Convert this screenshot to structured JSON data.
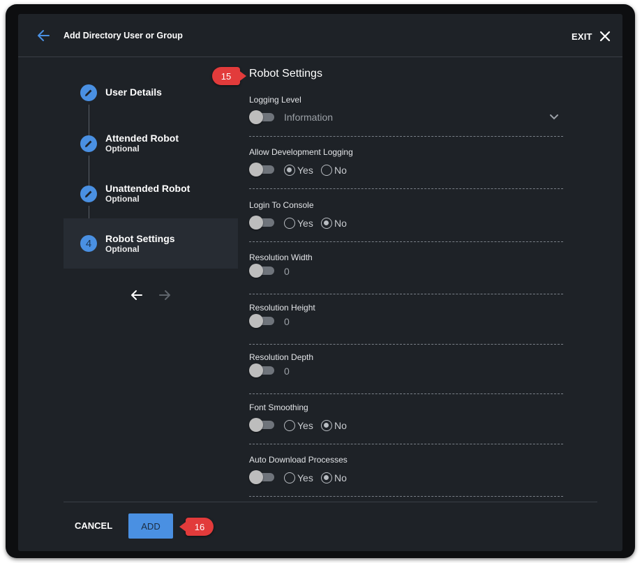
{
  "header": {
    "title": "Add Directory User or Group",
    "exit_label": "EXIT"
  },
  "stepper": {
    "steps": [
      {
        "title": "User Details",
        "subtitle": "",
        "icon": "pencil-icon"
      },
      {
        "title": "Attended Robot",
        "subtitle": "Optional",
        "icon": "pencil-icon"
      },
      {
        "title": "Unattended Robot",
        "subtitle": "Optional",
        "icon": "pencil-icon"
      },
      {
        "title": "Robot Settings",
        "subtitle": "Optional",
        "number": "4"
      }
    ]
  },
  "section": {
    "title": "Robot Settings"
  },
  "fields": {
    "logging_level": {
      "label": "Logging Level",
      "value": "Information"
    },
    "allow_dev_logging": {
      "label": "Allow Development Logging",
      "yes": "Yes",
      "no": "No",
      "selected": "Yes"
    },
    "login_to_console": {
      "label": "Login To Console",
      "yes": "Yes",
      "no": "No",
      "selected": "No"
    },
    "resolution_width": {
      "label": "Resolution Width",
      "value": "0"
    },
    "resolution_height": {
      "label": "Resolution Height",
      "value": "0"
    },
    "resolution_depth": {
      "label": "Resolution Depth",
      "value": "0"
    },
    "font_smoothing": {
      "label": "Font Smoothing",
      "yes": "Yes",
      "no": "No",
      "selected": "No"
    },
    "auto_download": {
      "label": "Auto Download Processes",
      "yes": "Yes",
      "no": "No",
      "selected": "No"
    }
  },
  "footer": {
    "cancel_label": "CANCEL",
    "add_label": "ADD"
  },
  "annotations": {
    "badge_1": "15",
    "badge_2": "16"
  },
  "colors": {
    "accent": "#4a90e2",
    "background": "#1e2227",
    "badge": "#e23b3b"
  }
}
